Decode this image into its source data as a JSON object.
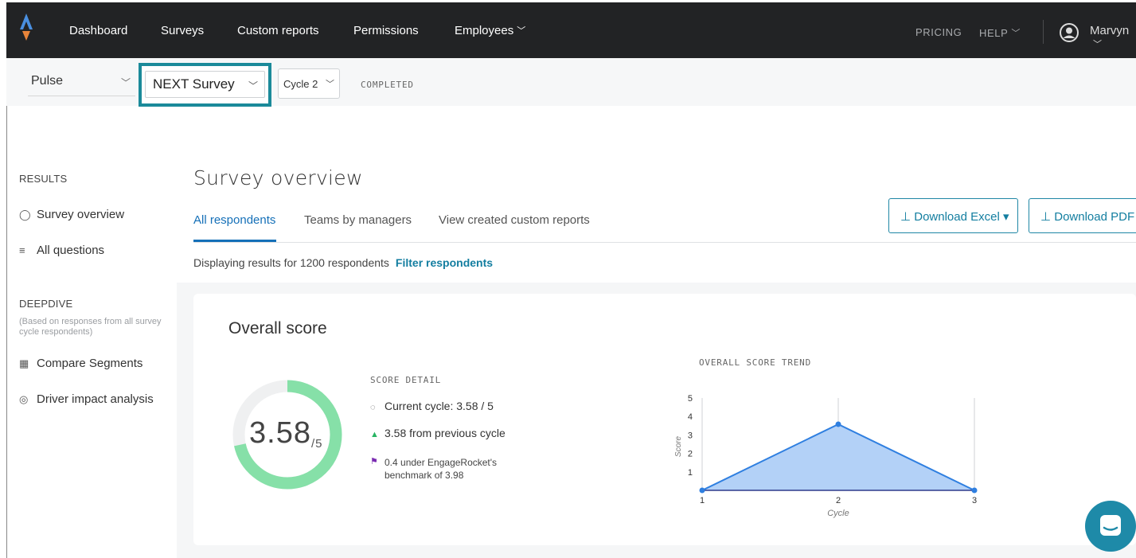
{
  "nav": {
    "items": [
      "Dashboard",
      "Surveys",
      "Custom reports",
      "Permissions",
      "Employees"
    ],
    "pricing": "PRICING",
    "help": "HELP",
    "user": "Marvyn"
  },
  "subbar": {
    "program": "Pulse",
    "survey": "NEXT Survey",
    "cycle": "Cycle 2",
    "status": "COMPLETED"
  },
  "sidebar": {
    "results_heading": "RESULTS",
    "survey_overview": "Survey overview",
    "all_questions": "All questions",
    "deepdive_heading": "DEEPDIVE",
    "deepdive_note": "(Based on responses from all survey cycle respondents)",
    "compare_segments": "Compare Segments",
    "driver_impact": "Driver impact analysis"
  },
  "main": {
    "title": "Survey overview",
    "tabs": [
      "All respondents",
      "Teams by managers",
      "View created custom reports"
    ],
    "download_excel": "⊥ Download Excel ▾",
    "download_pdf": "⊥ Download PDF",
    "displaying": "Displaying results for 1200 respondents",
    "filter": "Filter respondents"
  },
  "card": {
    "title": "Overall score",
    "score": "3.58",
    "score_max": "/5",
    "score_fraction": 0.716,
    "detail_label": "SCORE DETAIL",
    "current_cycle": "Current cycle: 3.58 / 5",
    "previous": "3.58 from previous cycle",
    "benchmark": "0.4 under EngageRocket's benchmark of 3.98",
    "trend_label": "OVERALL SCORE TREND"
  },
  "colors": {
    "accent": "#1b8a9a",
    "link": "#1570b8",
    "donut": "#86e0a8",
    "chart_fill": "#b3d1f7",
    "chart_line": "#2f7fe0"
  },
  "chart_data": {
    "type": "area",
    "x": [
      1,
      2,
      3
    ],
    "values": [
      0,
      3.58,
      0
    ],
    "xlabel": "Cycle",
    "ylabel": "Score",
    "ylim": [
      0,
      5
    ],
    "yticks": [
      1,
      2,
      3,
      4,
      5
    ],
    "xticks": [
      "1",
      "2",
      "3"
    ]
  }
}
